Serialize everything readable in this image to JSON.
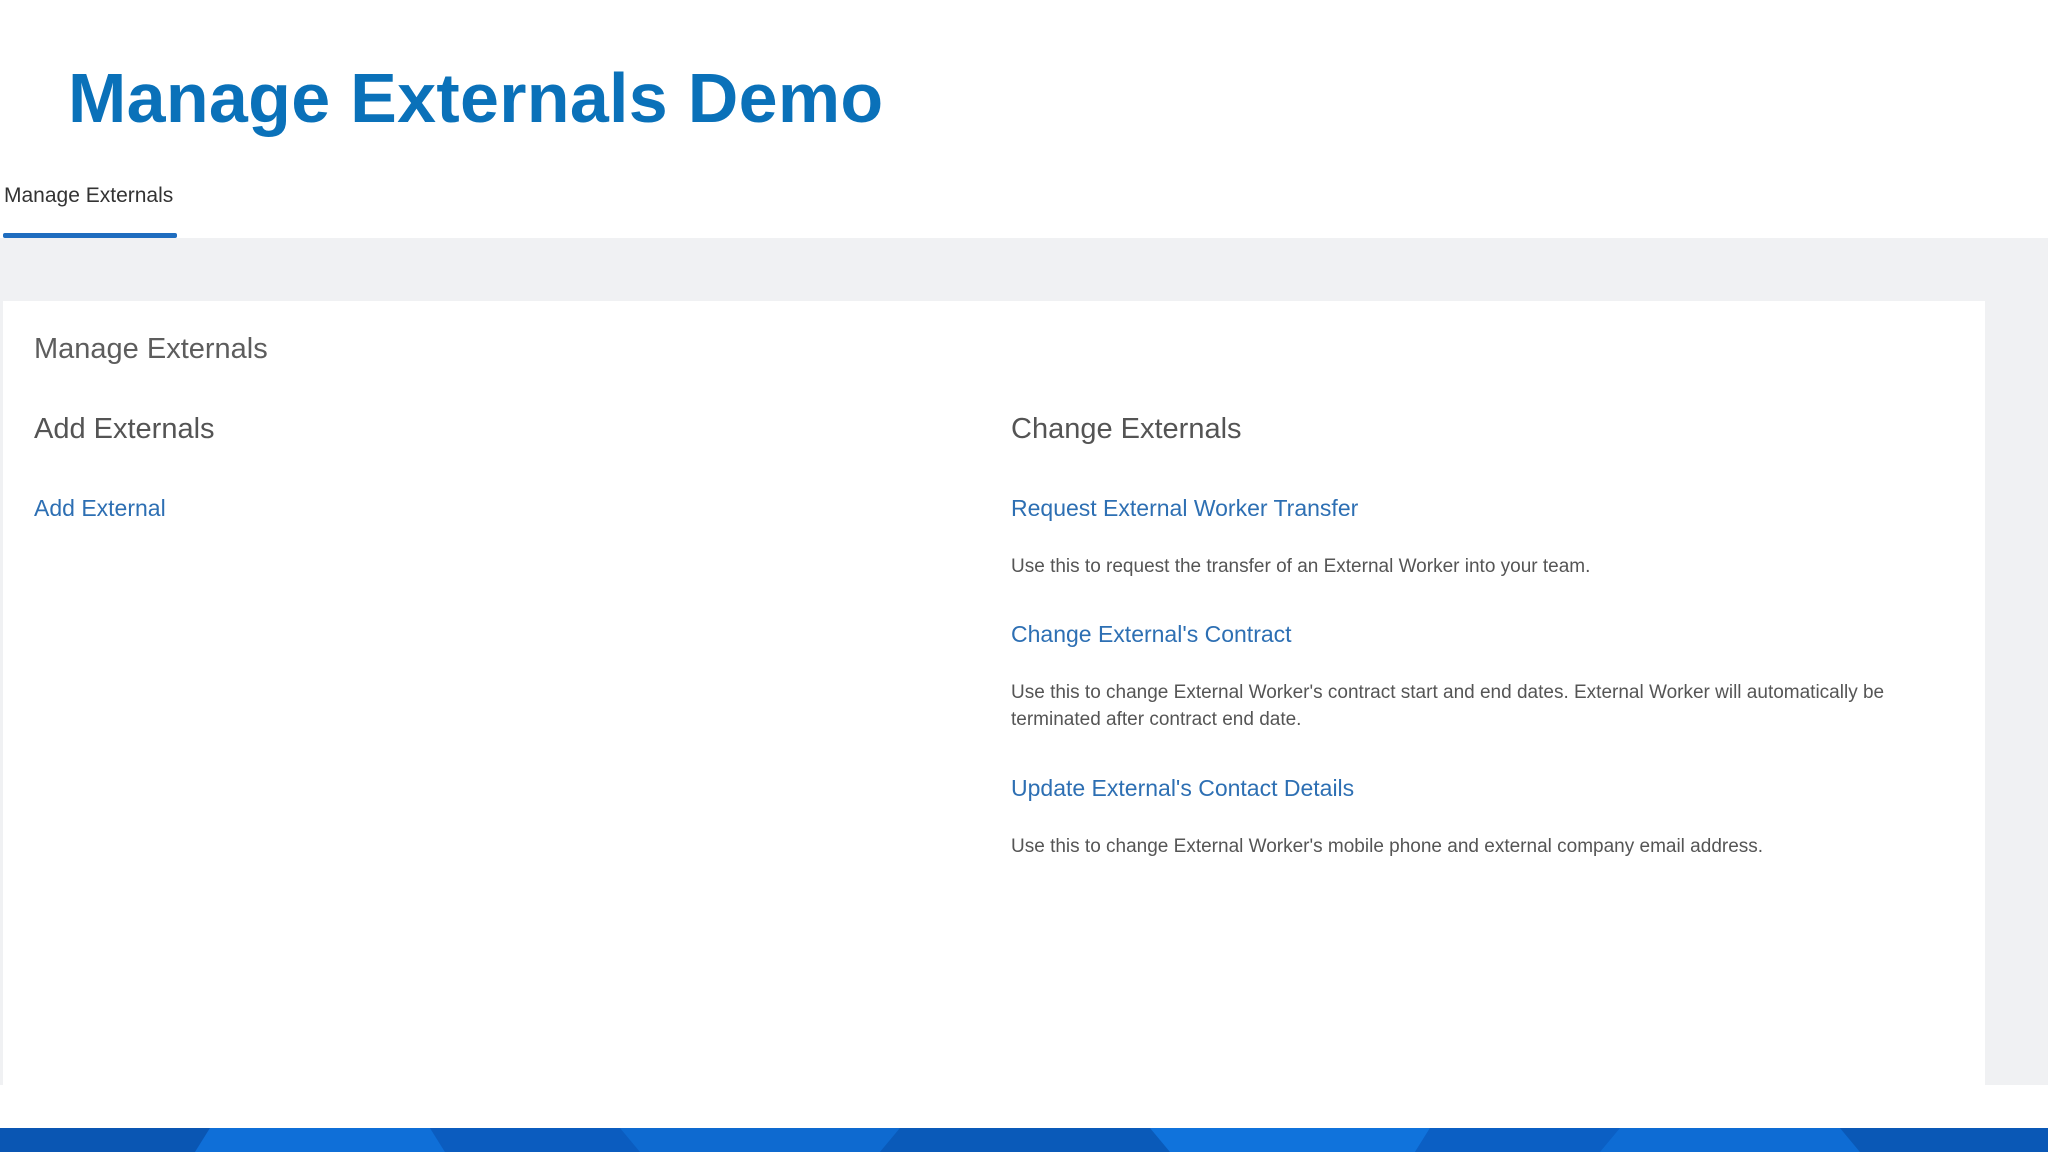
{
  "slide": {
    "title": "Manage Externals Demo",
    "title_color": "#0a71b9"
  },
  "tabs": [
    {
      "label": "Manage Externals",
      "active": true
    }
  ],
  "panel": {
    "title": "Manage Externals",
    "add_section": {
      "heading": "Add Externals",
      "links": [
        {
          "label": "Add External"
        }
      ]
    },
    "change_section": {
      "heading": "Change Externals",
      "tasks": [
        {
          "label": "Request External Worker Transfer",
          "description": "Use this to request the transfer of an External Worker into your team."
        },
        {
          "label": "Change External's Contract",
          "description": "Use this to change External Worker's contract start and end dates. External Worker will automatically be terminated after contract end date."
        },
        {
          "label": "Update External's Contact Details",
          "description": "Use this to change External Worker's mobile phone and external company email address."
        }
      ]
    }
  },
  "colors": {
    "link": "#2d6fb3",
    "tab_underline": "#1f6dbf",
    "background": "#f0f1f3",
    "band": "#0b62c9"
  }
}
